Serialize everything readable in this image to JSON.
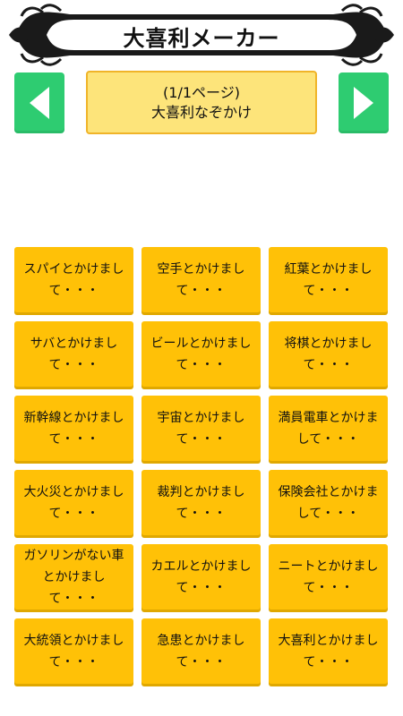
{
  "header": {
    "title": "大喜利メーカー"
  },
  "nav": {
    "prev_icon": "triangle-left-icon",
    "next_icon": "triangle-right-icon",
    "accent": "#2ecc71"
  },
  "page_info": {
    "page_label": "(1/1ページ)",
    "category": "大喜利なぞかけ"
  },
  "topics": [
    "スパイとかけまして・・・",
    "空手とかけまして・・・",
    "紅葉とかけまして・・・",
    "サバとかけまして・・・",
    "ビールとかけまして・・・",
    "将棋とかけまして・・・",
    "新幹線とかけまして・・・",
    "宇宙とかけまして・・・",
    "満員電車とかけまして・・・",
    "大火災とかけまして・・・",
    "裁判とかけまして・・・",
    "保険会社とかけまして・・・",
    "ガソリンがない車とかけまして・・・",
    "カエルとかけまして・・・",
    "ニートとかけまして・・・",
    "大統領とかけまして・・・",
    "急患とかけまして・・・",
    "大喜利とかけまして・・・"
  ],
  "colors": {
    "card": "#ffc107",
    "page_box": "#fde47a",
    "page_border": "#f0b429"
  }
}
